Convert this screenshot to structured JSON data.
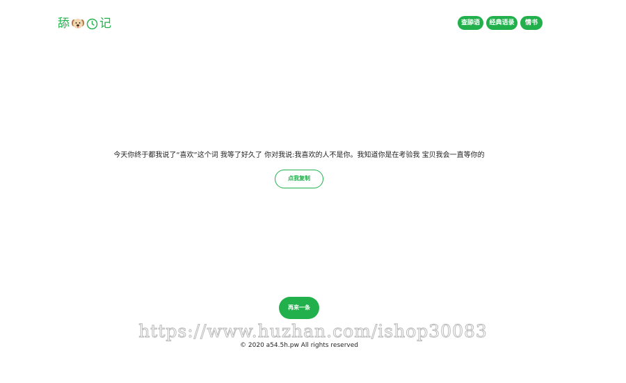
{
  "header": {
    "logo_prefix": "舔",
    "logo_suffix": "记",
    "logo_icons": [
      "dog-face-icon",
      "clock-icon"
    ],
    "nav": [
      {
        "label": "查舔语"
      },
      {
        "label": "经典语录"
      },
      {
        "label": "情书"
      }
    ]
  },
  "main": {
    "quote": "今天你终于都我说了“喜欢”这个词 我等了好久了 你对我说:我喜欢的人不是你。我知道你是在考验我 宝贝我会一直等你的",
    "copy_button": "点我复制",
    "again_button": "再来一条"
  },
  "watermark": "https://www.huzhan.com/ishop30083",
  "footer": {
    "copyright": "© 2020 a54.5h.pw All rights reserved"
  },
  "colors": {
    "accent": "#21b04b",
    "text": "#222222",
    "background": "#ffffff"
  }
}
